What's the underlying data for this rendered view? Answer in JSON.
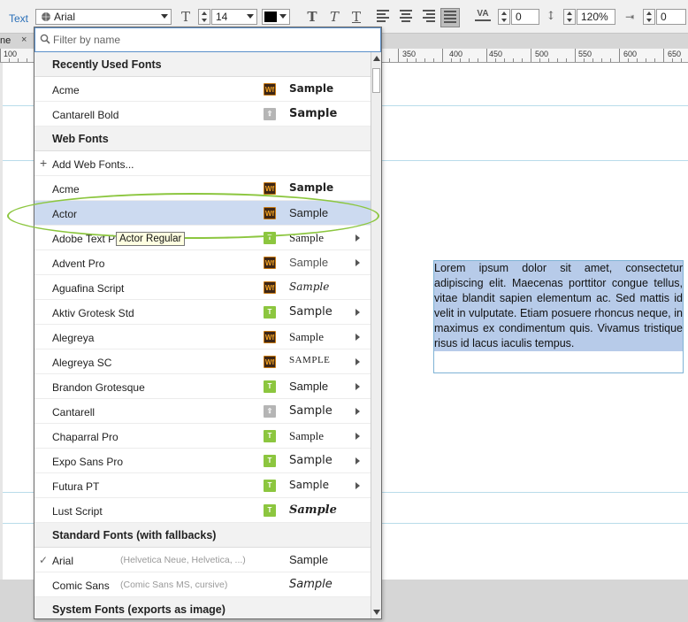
{
  "toolbar": {
    "text_label": "Text",
    "font_family": "Arial",
    "font_size": "14",
    "color_swatch": "#000000",
    "letter_spacing": "0",
    "line_height": "120%",
    "paragraph_indent": "0"
  },
  "tab": {
    "label": "ne"
  },
  "ruler": {
    "ticks": [
      "100",
      "350",
      "400",
      "450",
      "500",
      "550",
      "600",
      "650"
    ]
  },
  "dropdown": {
    "filter_placeholder": "Filter by name",
    "sections": {
      "recently_used": "Recently Used Fonts",
      "web_fonts": "Web Fonts",
      "standard_fonts": "Standard Fonts (with fallbacks)",
      "system_fonts": "System Fonts (exports as image)"
    },
    "add_web_fonts": "Add Web Fonts...",
    "recent_items": [
      {
        "name": "Acme",
        "badge": "web",
        "sample": "Sample"
      },
      {
        "name": "Cantarell Bold",
        "badge": "local",
        "sample": "Sample"
      }
    ],
    "web_items": [
      {
        "name": "Acme",
        "badge": "web",
        "sample": "Sample"
      },
      {
        "name": "Actor",
        "badge": "web",
        "sample": "Sample"
      },
      {
        "name": "Adobe Text Pro",
        "badge": "adobe",
        "sample": "Sample"
      },
      {
        "name": "Advent Pro",
        "badge": "web",
        "sample": "Sample"
      },
      {
        "name": "Aguafina Script",
        "badge": "web",
        "sample": "Sample"
      },
      {
        "name": "Aktiv Grotesk Std",
        "badge": "adobe",
        "sample": "Sample"
      },
      {
        "name": "Alegreya",
        "badge": "web",
        "sample": "Sample"
      },
      {
        "name": "Alegreya SC",
        "badge": "web",
        "sample": "SAMPLE"
      },
      {
        "name": "Brandon Grotesque",
        "badge": "adobe",
        "sample": "Sample"
      },
      {
        "name": "Cantarell",
        "badge": "local",
        "sample": "Sample"
      },
      {
        "name": "Chaparral Pro",
        "badge": "adobe",
        "sample": "Sample"
      },
      {
        "name": "Expo Sans Pro",
        "badge": "adobe",
        "sample": "Sample"
      },
      {
        "name": "Futura PT",
        "badge": "adobe",
        "sample": "Sample"
      },
      {
        "name": "Lust Script",
        "badge": "adobe",
        "sample": "Sample"
      }
    ],
    "standard_items": [
      {
        "name": "Arial",
        "fallback": "(Helvetica Neue, Helvetica, ...)",
        "sample": "Sample"
      },
      {
        "name": "Comic Sans",
        "fallback": "(Comic Sans MS, cursive)",
        "sample": "Sample"
      }
    ],
    "badge_text": {
      "web": "Wf",
      "adobe": "T",
      "local": "⇧"
    }
  },
  "tooltip": "Actor Regular",
  "canvas": {
    "lorem": "Lorem ipsum dolor sit amet, consectetur adipiscing elit. Maecenas porttitor congue tellus, vitae blandit sapien elementum ac. Sed mattis id velit in vulputate. Etiam posuere rhoncus neque, in maximus ex condimentum quis. Vivamus tristique risus id lacus iaculis tempus."
  },
  "colors": {
    "accent": "#2a6fb8",
    "selected_row": "#ccdaf0",
    "highlight_ring": "#8cc63f",
    "text_selection": "#b7cbe9"
  }
}
